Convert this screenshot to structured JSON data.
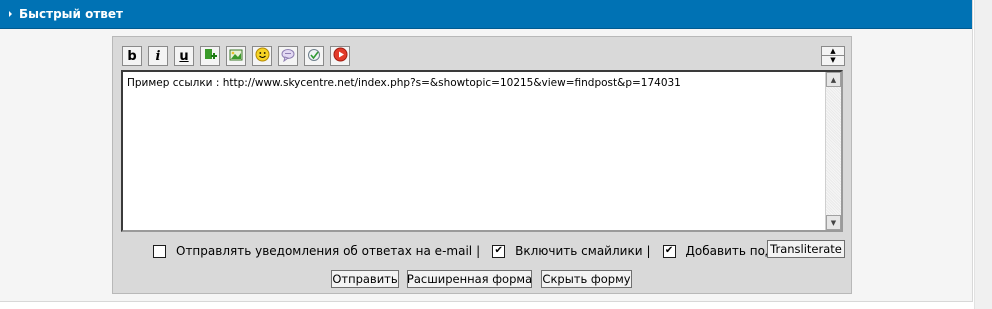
{
  "header": {
    "title": "Быстрый ответ"
  },
  "toolbar": {
    "bold": "b",
    "italic": "i",
    "underline": "u",
    "icons": [
      "add-link-icon",
      "insert-image-icon",
      "smiley-icon",
      "quote-icon",
      "spellcheck-icon",
      "media-icon"
    ],
    "resize_icons": [
      "expand-up-icon",
      "collapse-down-icon"
    ]
  },
  "editor": {
    "text": "Пример ссылки : http://www.skycentre.net/index.php?s=&showtopic=10215&view=findpost&p=174031"
  },
  "options": {
    "email_notify": {
      "label": "Отправлять уведомления об ответах на e-mail",
      "checked": false
    },
    "separator1": "|",
    "enable_smilies": {
      "label": "Включить смайлики",
      "checked": true
    },
    "separator2": "|",
    "add_signature": {
      "label": "Добавить подпись",
      "checked": true
    }
  },
  "buttons": {
    "transliterate": "Transliterate",
    "submit": "Отправить",
    "extended_form": "Расширенная форма",
    "hide_form": "Скрыть форму"
  },
  "colors": {
    "header_bg": "#0072b4",
    "panel_bg": "#d9d9d9"
  }
}
